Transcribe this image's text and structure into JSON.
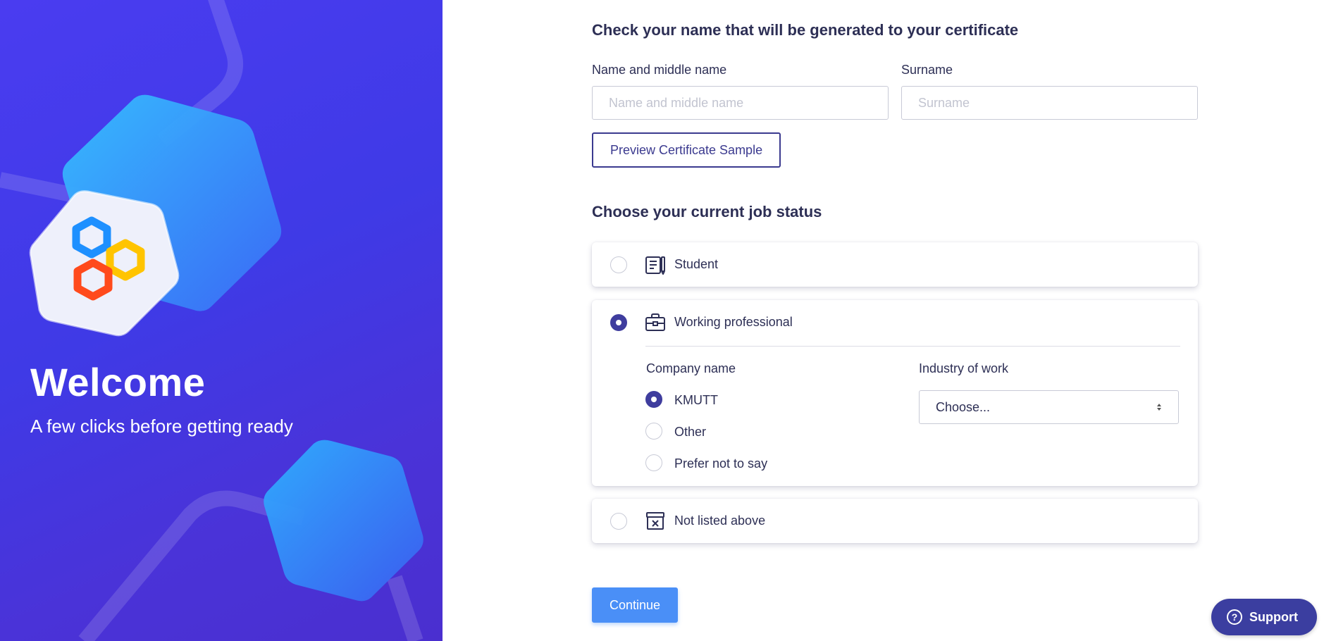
{
  "hero": {
    "title": "Welcome",
    "subtitle": "A few clicks before getting ready"
  },
  "certificate": {
    "heading": "Check your name that will be generated to your certificate",
    "name_label": "Name and middle name",
    "name_placeholder": "Name and middle name",
    "name_value": "",
    "surname_label": "Surname",
    "surname_placeholder": "Surname",
    "surname_value": "",
    "preview_button": "Preview Certificate Sample"
  },
  "job_status": {
    "heading": "Choose your current job status",
    "options": [
      {
        "label": "Student",
        "icon": "notebook-icon",
        "selected": false
      },
      {
        "label": "Working professional",
        "icon": "briefcase-icon",
        "selected": true
      },
      {
        "label": "Not listed above",
        "icon": "archive-x-icon",
        "selected": false
      }
    ],
    "company": {
      "label": "Company name",
      "options": [
        {
          "label": "KMUTT",
          "selected": true
        },
        {
          "label": "Other",
          "selected": false
        },
        {
          "label": "Prefer not to say",
          "selected": false
        }
      ]
    },
    "industry": {
      "label": "Industry of work",
      "selected": "Choose..."
    }
  },
  "actions": {
    "continue": "Continue",
    "support": "Support"
  },
  "colors": {
    "primary": "#4a8ff7",
    "accent": "#3f3d9e",
    "panel": "#4a3cf0",
    "text": "#2d2f55"
  }
}
